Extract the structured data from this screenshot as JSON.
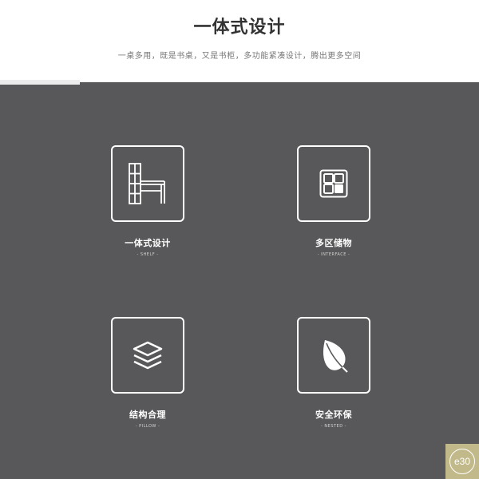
{
  "header": {
    "title": "一体式设计",
    "subtitle": "一桌多用，既是书桌，又是书柜，多功能紧凑设计，腾出更多空间"
  },
  "features": [
    {
      "title": "一体式设计",
      "subtitle": "- SHELF -",
      "icon": "desk-shelf-icon"
    },
    {
      "title": "多区储物",
      "subtitle": "- INTERFACE -",
      "icon": "storage-grid-icon"
    },
    {
      "title": "结构合理",
      "subtitle": "- PILLOW -",
      "icon": "layers-icon"
    },
    {
      "title": "安全环保",
      "subtitle": "- NESTED -",
      "icon": "leaf-icon"
    }
  ],
  "badge": {
    "text": "e30"
  },
  "colors": {
    "panel_bg": "#58585a",
    "badge_bg": "#c2b98a",
    "title_text": "#333333"
  }
}
